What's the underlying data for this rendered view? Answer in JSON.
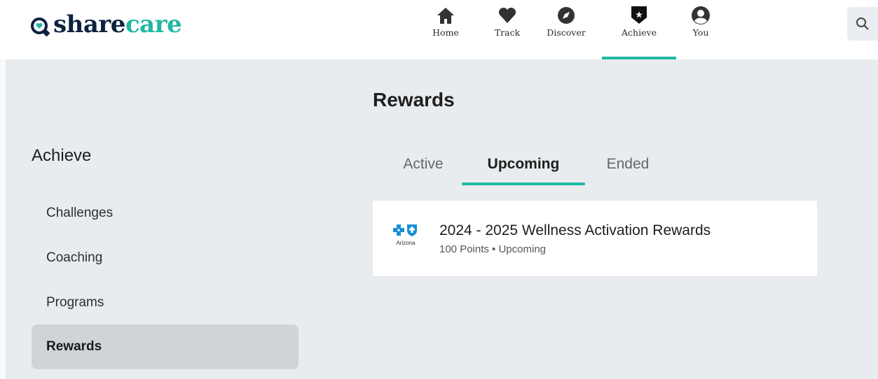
{
  "brand": {
    "logo_text_share": "share",
    "logo_text_care": "care",
    "colors": {
      "navy": "#0d2240",
      "teal": "#20b8a4",
      "background": "#e8ecef"
    }
  },
  "nav": {
    "items": [
      {
        "label": "Home",
        "icon": "home-icon",
        "active": false
      },
      {
        "label": "Track",
        "icon": "heart-icon",
        "active": false
      },
      {
        "label": "Discover",
        "icon": "compass-icon",
        "active": false
      },
      {
        "label": "Achieve",
        "icon": "star-shield-icon",
        "active": true
      },
      {
        "label": "You",
        "icon": "user-icon",
        "active": false
      }
    ]
  },
  "search": {
    "icon": "search-icon"
  },
  "sidebar": {
    "title": "Achieve",
    "items": [
      {
        "label": "Challenges",
        "active": false
      },
      {
        "label": "Coaching",
        "active": false
      },
      {
        "label": "Programs",
        "active": false
      },
      {
        "label": "Rewards",
        "active": true
      }
    ]
  },
  "main": {
    "title": "Rewards",
    "tabs": [
      {
        "label": "Active",
        "active": false
      },
      {
        "label": "Upcoming",
        "active": true
      },
      {
        "label": "Ended",
        "active": false
      }
    ],
    "rewards": [
      {
        "title": "2024 - 2025 Wellness Activation Rewards",
        "subtitle": "100 Points • Upcoming",
        "sponsor_logo_text": "Arizona",
        "sponsor_logo_icon": "blue-cross-blue-shield-icon"
      }
    ]
  }
}
